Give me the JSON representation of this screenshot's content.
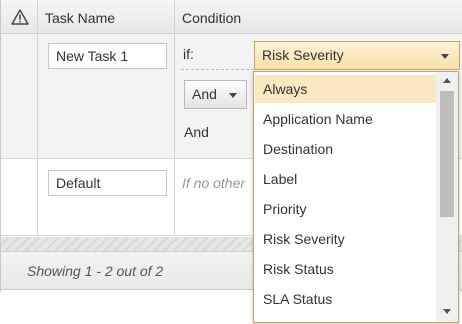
{
  "header": {
    "warning_icon": "warning-triangle-icon",
    "task_name_label": "Task Name",
    "condition_label": "Condition"
  },
  "rows": [
    {
      "task_name_value": "New Task 1",
      "if_label": "if:",
      "condition_select_value": "Risk Severity",
      "and_button_label": "And",
      "and_label": "And"
    },
    {
      "task_name_value": "Default",
      "condition_placeholder": "If no other"
    }
  ],
  "footer": {
    "status_text": "Showing 1 - 2 out of 2"
  },
  "dropdown": {
    "options": [
      "Always",
      "Application Name",
      "Destination",
      "Label",
      "Priority",
      "Risk Severity",
      "Risk Status",
      "SLA Status"
    ],
    "highlighted_option": "Always"
  },
  "colors": {
    "accent_border": "#c3a46a",
    "select_bg": "#f6dfa9",
    "highlight_bg": "#fbe7c2"
  }
}
